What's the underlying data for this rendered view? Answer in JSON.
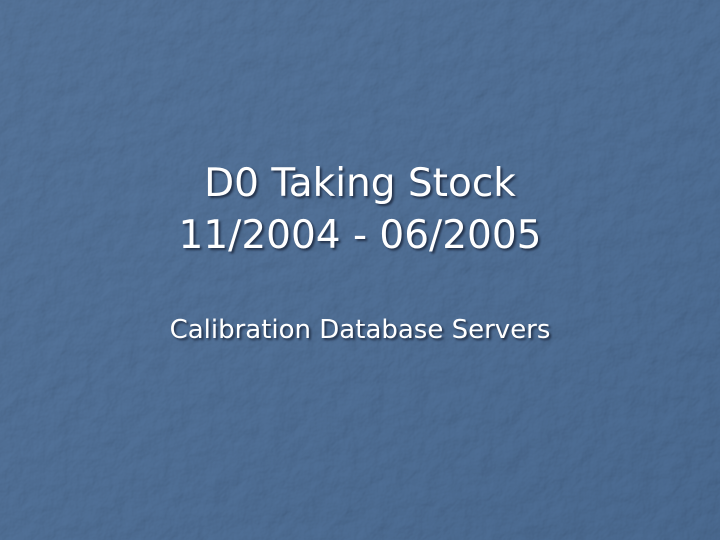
{
  "slide": {
    "title_lines": [
      "D0 Taking Stock",
      "11/2004 - 06/2005"
    ],
    "subtitle": "Calibration Database Servers"
  },
  "theme": {
    "background": "#4f6f96",
    "text_color": "#ffffff"
  }
}
